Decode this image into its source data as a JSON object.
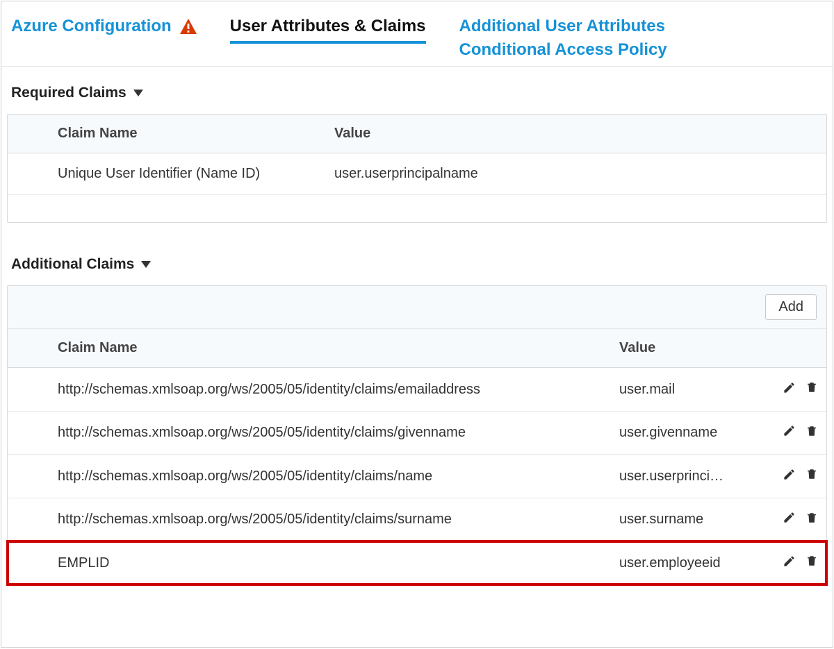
{
  "tabs": {
    "azure": "Azure Configuration",
    "attrs": "User Attributes & Claims",
    "additional": "Additional User Attributes",
    "conditional": "Conditional Access Policy"
  },
  "required": {
    "title": "Required Claims",
    "headers": {
      "name": "Claim Name",
      "value": "Value"
    },
    "rows": [
      {
        "name": "Unique User Identifier (Name ID)",
        "value": "user.userprincipalname"
      }
    ]
  },
  "additional": {
    "title": "Additional Claims",
    "add_label": "Add",
    "headers": {
      "name": "Claim Name",
      "value": "Value"
    },
    "rows": [
      {
        "name": "http://schemas.xmlsoap.org/ws/2005/05/identity/claims/emailaddress",
        "value": "user.mail"
      },
      {
        "name": "http://schemas.xmlsoap.org/ws/2005/05/identity/claims/givenname",
        "value": "user.givenname"
      },
      {
        "name": "http://schemas.xmlsoap.org/ws/2005/05/identity/claims/name",
        "value": "user.userprinci…"
      },
      {
        "name": "http://schemas.xmlsoap.org/ws/2005/05/identity/claims/surname",
        "value": "user.surname"
      },
      {
        "name": "EMPLID",
        "value": "user.employeeid"
      }
    ]
  }
}
